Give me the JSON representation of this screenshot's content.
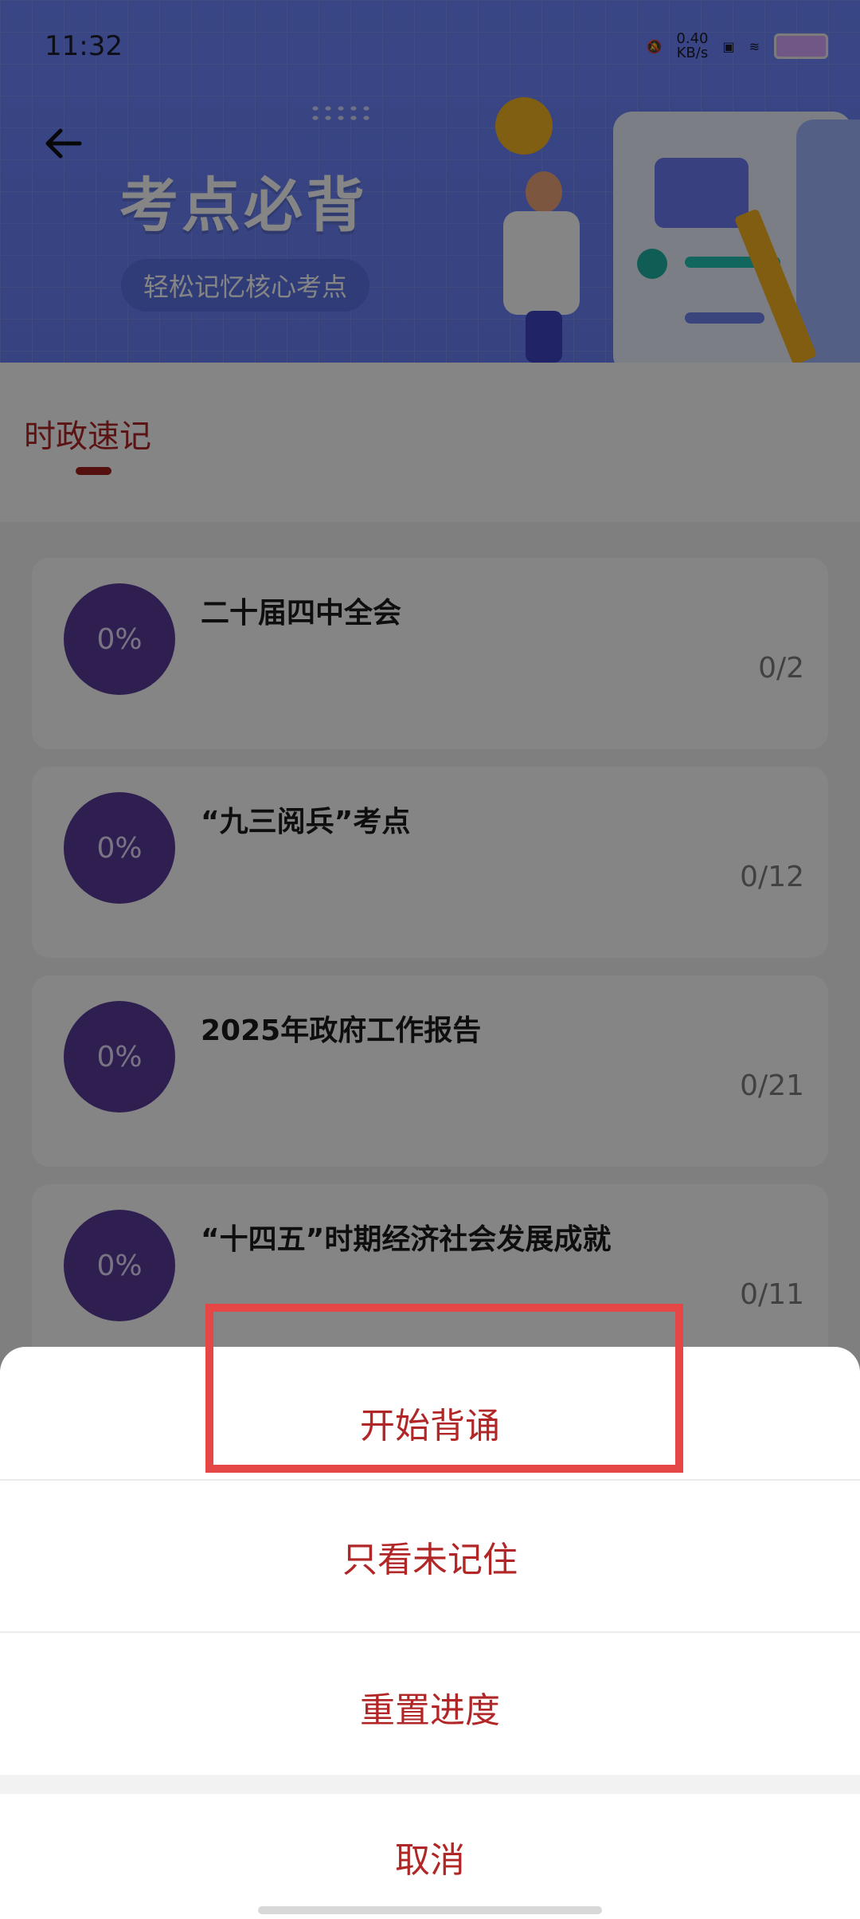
{
  "status_bar": {
    "time": "11:32",
    "net_speed_value": "0.40",
    "net_speed_unit": "KB/s"
  },
  "header": {
    "back_icon": "arrow-left-icon",
    "title": "考点必背",
    "subtitle": "轻松记忆核心考点"
  },
  "tabs": [
    {
      "label": "时政速记",
      "active": true
    }
  ],
  "list": {
    "items": [
      {
        "progress": "0%",
        "title": "二十届四中全会",
        "count": "0/2"
      },
      {
        "progress": "0%",
        "title": "“九三阅兵”考点",
        "count": "0/12"
      },
      {
        "progress": "0%",
        "title": "2025年政府工作报告",
        "count": "0/21"
      },
      {
        "progress": "0%",
        "title": "“十四五”时期经济社会发展成就",
        "count": "0/11"
      }
    ]
  },
  "sheet": {
    "start": "开始背诵",
    "unremembered": "只看未记住",
    "reset": "重置进度",
    "cancel": "取消"
  },
  "colors": {
    "accent": "#b12626",
    "banner": "#6e86ff",
    "progress_circle": "#5b3c9a",
    "highlight": "#e54646"
  }
}
